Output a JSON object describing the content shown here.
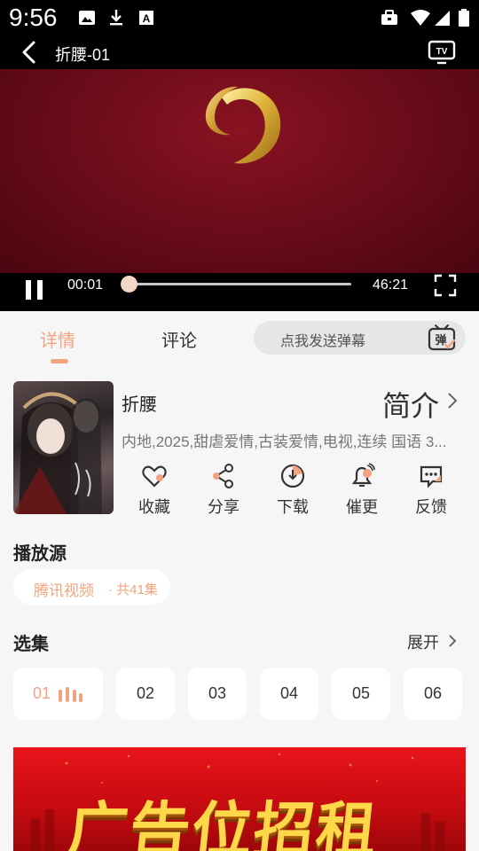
{
  "status_bar": {
    "time": "9:56"
  },
  "title_bar": {
    "title": "折腰-01"
  },
  "player": {
    "current_time": "00:01",
    "total_time": "46:21",
    "progress": 0.02
  },
  "tabs": {
    "details_label": "详情",
    "comments_label": "评论",
    "danmu_placeholder": "点我发送弹幕",
    "danmu_icon_text": "弹"
  },
  "info": {
    "title": "折腰",
    "intro_label": "简介",
    "meta": "内地,2025,甜虐爱情,古装爱情,电视,连续 国语 3..."
  },
  "actions": [
    {
      "label": "收藏",
      "icon": "heart-icon"
    },
    {
      "label": "分享",
      "icon": "share-icon"
    },
    {
      "label": "下载",
      "icon": "download-icon"
    },
    {
      "label": "催更",
      "icon": "bell-icon"
    },
    {
      "label": "反馈",
      "icon": "feedback-icon"
    }
  ],
  "source": {
    "title": "播放源",
    "name": "腾讯视频",
    "count": "· 共41集"
  },
  "episodes": {
    "title": "选集",
    "expand_label": "展开",
    "items": [
      "01",
      "02",
      "03",
      "04",
      "05",
      "06"
    ]
  },
  "ad": {
    "text": "广告位招租"
  },
  "colors": {
    "accent": "#f3a37f",
    "background": "#f6f6f6",
    "video_bg": "#6d0c1a"
  }
}
